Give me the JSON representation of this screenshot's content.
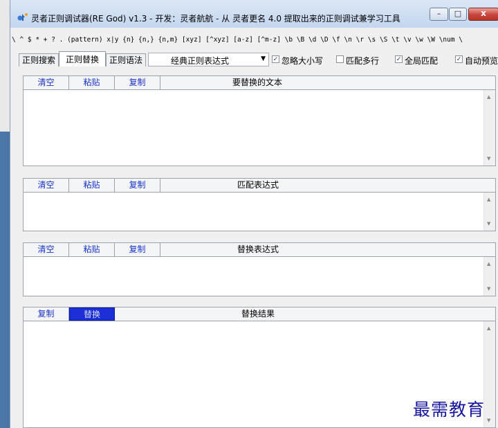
{
  "window": {
    "title": "灵者正则调试器(RE God) v1.3 - 开发：灵者航航 - 从 灵者更名 4.0 提取出来的正则调试兼学习工具",
    "minimize_glyph": "–",
    "maximize_glyph": "□",
    "close_glyph": "x"
  },
  "symbol_bar": "\\ ^ $ * + ? . (pattern) x|y {n} {n,} {n,m} [xyz] [^xyz] [a-z] [^m-z] \\b \\B \\d \\D \\f \\n \\r \\s \\S \\t \\v \\w \\W \\num \\",
  "tabs": [
    "正则搜索",
    "正则替换",
    "正则语法"
  ],
  "active_tab": "正则替换",
  "preset": {
    "value": "经典正则表达式"
  },
  "options": [
    {
      "label": "忽略大小写",
      "checked": true
    },
    {
      "label": "匹配多行",
      "checked": false
    },
    {
      "label": "全局匹配",
      "checked": true
    },
    {
      "label": "自动预览",
      "checked": true
    }
  ],
  "sections": {
    "source_text": {
      "buttons": [
        "清空",
        "粘贴",
        "复制"
      ],
      "title": "要替换的文本"
    },
    "match_expression": {
      "buttons": [
        "清空",
        "粘贴",
        "复制"
      ],
      "title": "匹配表达式"
    },
    "replace_expression": {
      "buttons": [
        "清空",
        "粘贴",
        "复制"
      ],
      "title": "替换表达式"
    },
    "result": {
      "buttons": [
        "复制",
        "替换"
      ],
      "title": "替换结果"
    }
  },
  "watermark": "最需教育"
}
